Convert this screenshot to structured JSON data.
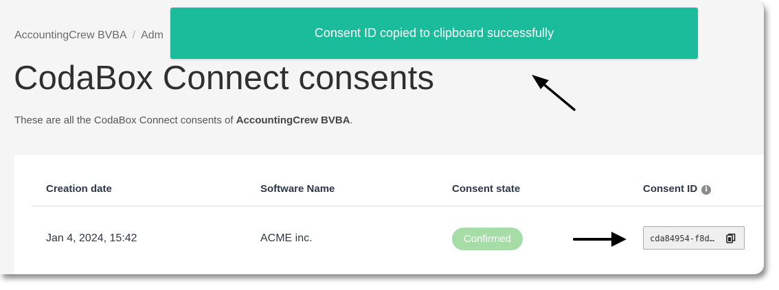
{
  "breadcrumb": {
    "company": "AccountingCrew BVBA",
    "separator": "/",
    "partial": "Adm"
  },
  "page": {
    "title": "CodaBox Connect consents",
    "description_prefix": "These are all the CodaBox Connect consents of ",
    "description_company": "AccountingCrew BVBA",
    "description_suffix": "."
  },
  "table": {
    "headers": {
      "creation_date": "Creation date",
      "software_name": "Software Name",
      "consent_state": "Consent state",
      "consent_id": "Consent ID"
    },
    "rows": [
      {
        "creation_date": "Jan 4, 2024, 15:42",
        "software_name": "ACME inc.",
        "consent_state": "Confirmed",
        "consent_id": "cda84954-f8d…"
      }
    ]
  },
  "toast": {
    "message": "Consent ID copied to clipboard successfully"
  },
  "icons": {
    "info": "info-icon",
    "copy": "copy-icon",
    "annotation_arrows": "arrow-icon"
  },
  "colors": {
    "toast_background": "#1bbc9b",
    "badge_confirmed": "#a6dca6",
    "page_background": "#f5f5f5"
  }
}
